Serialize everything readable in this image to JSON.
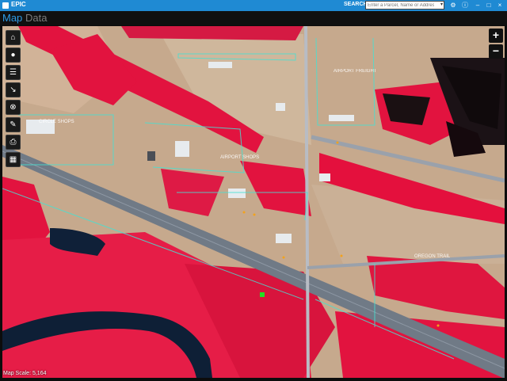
{
  "app": {
    "title": "EPIC"
  },
  "search": {
    "label": "SEARCH:",
    "placeholder": "Enter a Parcel, Name or Address"
  },
  "window_icons": [
    "settings-icon",
    "info-icon",
    "minimize-icon",
    "maximize-icon",
    "close-icon"
  ],
  "nav": {
    "tabs": [
      {
        "label": "Map",
        "active": true
      },
      {
        "label": "Data",
        "active": false
      }
    ]
  },
  "tools": [
    "home-icon",
    "map-pin-icon",
    "layers-list-icon",
    "measure-icon",
    "clear-icon",
    "draw-icon",
    "print-icon",
    "basemap-grid-icon"
  ],
  "zoom": {
    "in": "+",
    "out": "−"
  },
  "map": {
    "scale_text": "Map Scale: 5,164",
    "labels": [
      "CIRCLE SHOPS",
      "AIRPORT FREIGHT",
      "AIRPORT SHOPS",
      "OREGON TRAIL"
    ],
    "colors": {
      "vegetation": "#e2133f",
      "ground": "#c6a98d",
      "highway": "#707a86",
      "water": "#0e1f36",
      "parcel_lines": "#47e0d2",
      "accent": "#1f8ad3"
    }
  }
}
